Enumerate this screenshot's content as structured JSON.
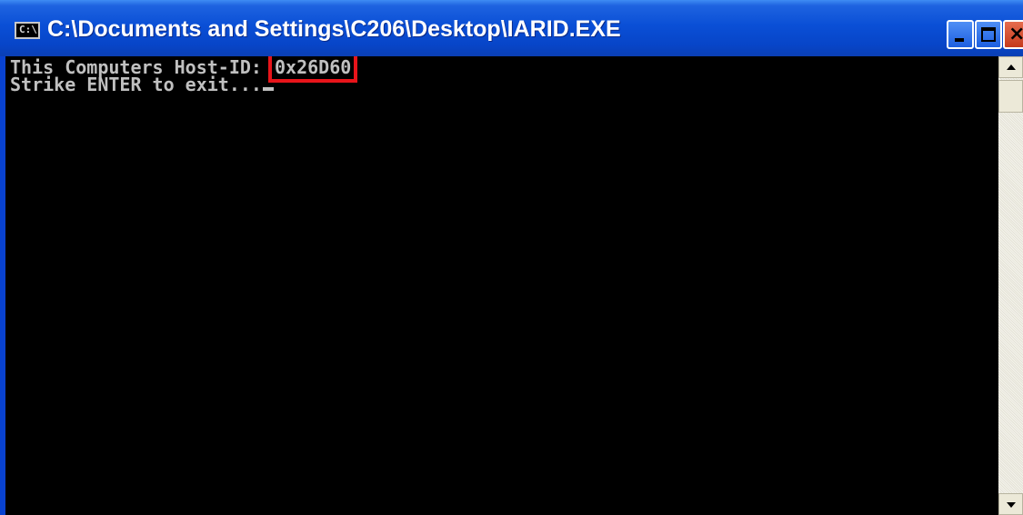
{
  "window": {
    "title": "C:\\Documents and Settings\\C206\\Desktop\\IARID.EXE",
    "app_icon_text": "C:\\",
    "close_glyph": "×"
  },
  "console": {
    "line1_prefix": "This Computers Host-ID: ",
    "host_id": "0x26D60",
    "line2": "Strike ENTER to exit..."
  },
  "icons": {
    "app": "console-app-icon",
    "minimize": "minimize-icon",
    "maximize": "maximize-icon",
    "close": "close-icon",
    "scroll_up": "scroll-up-arrow-icon",
    "scroll_down": "scroll-down-arrow-icon"
  },
  "colors": {
    "titlebar": "#0a4fd6",
    "console_bg": "#000000",
    "console_text": "#c0c0c0",
    "highlight_box": "#e8141a"
  }
}
